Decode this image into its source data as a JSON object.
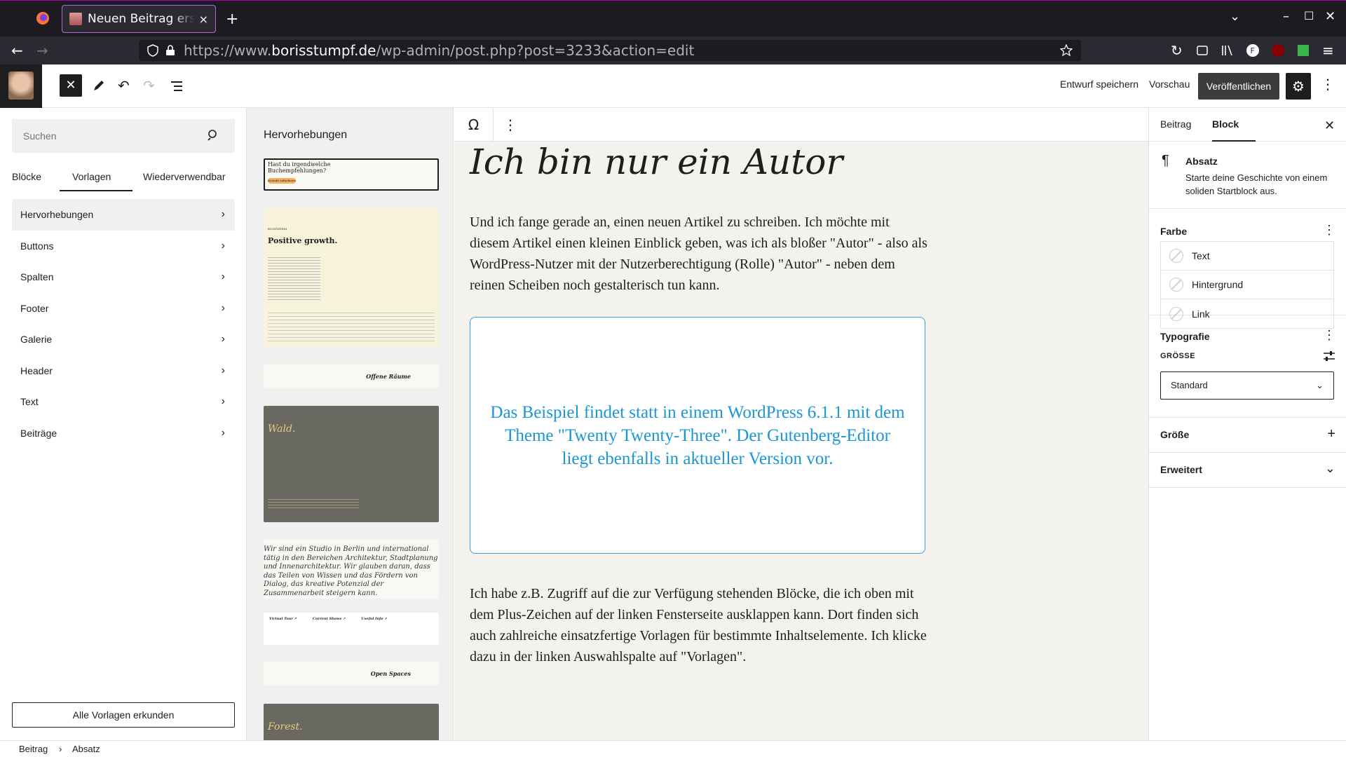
{
  "browser": {
    "tab_title": "Neuen Beitrag erstellen",
    "tab_close": "×",
    "new_tab": "+",
    "url_host_prefix": "https://www.",
    "url_host": "borisstumpf.de",
    "url_path": "/wp-admin/post.php?post=3233&action=edit"
  },
  "wp_topbar": {
    "close_symbol": "✕",
    "save_draft": "Entwurf speichern",
    "preview": "Vorschau",
    "publish": "Veröffentlichen"
  },
  "inserter": {
    "search_placeholder": "Suchen",
    "tabs": [
      "Blöcke",
      "Vorlagen",
      "Wiederverwendbar"
    ],
    "active_tab": "Vorlagen",
    "categories": [
      "Hervorhebungen",
      "Buttons",
      "Spalten",
      "Footer",
      "Galerie",
      "Header",
      "Text",
      "Beiträge"
    ],
    "explore_button": "Alle Vorlagen erkunden"
  },
  "patterns": {
    "title": "Hervorhebungen",
    "p1_text": "Hast du irgendwelche Buchempfehlungen?",
    "p1_button": "Kontakt aufnehmen",
    "p2_kicker": "ECOSYSTEM",
    "p2_heading": "Positive growth.",
    "p3_text": "Offene Räume",
    "p4_text": "Wald.",
    "p5_text": "Wir sind ein Studio in Berlin und international tätig in den Bereichen Architektur, Stadtplanung und Innenarchitektur. Wir glauben daran, dass das Teilen von Wissen und das Fördern von Dialog, das kreative Potenzial der Zusammenarbeit steigern kann.",
    "p6_cols": [
      "Virtual Tour ↗",
      "Current Shows ↗",
      "Useful Info ↗"
    ],
    "p7_text": "Open Spaces",
    "p8_text": "Forest."
  },
  "editor": {
    "omega": "Ω",
    "heading": "Ich bin nur ein Autor",
    "para1": "Und ich fange gerade an, einen neuen Artikel zu schreiben. Ich möchte mit diesem Artikel einen kleinen Einblick geben, was ich als bloßer \"Autor\" - also als WordPress-Nutzer mit der Nutzerberechtigung (Rolle) \"Autor\" - neben dem reinen Scheiben noch gestalterisch tun kann.",
    "callout": "Das Beispiel findet statt in einem WordPress 6.1.1 mit dem Theme \"Twenty Twenty-Three\". Der Gutenberg-Editor liegt ebenfalls in aktueller Version vor.",
    "para2": "Ich habe z.B. Zugriff auf die zur Verfügung stehenden Blöcke, die ich oben mit dem Plus-Zeichen auf der linken Fensterseite ausklappen kann. Dort finden sich auch zahlreiche einsatzfertige Vorlagen für bestimmte Inhaltselemente. Ich klicke dazu in der linken Auswahlspalte auf \"Vorlagen\"."
  },
  "sidebar": {
    "tab_post": "Beitrag",
    "tab_block": "Block",
    "block_name": "Absatz",
    "block_desc": "Starte deine Geschichte von einem soliden Startblock aus.",
    "color_title": "Farbe",
    "color_items": [
      "Text",
      "Hintergrund",
      "Link"
    ],
    "typo_title": "Typografie",
    "size_label": "GRÖSSE",
    "size_value": "Standard",
    "dimension_title": "Größe",
    "advanced_title": "Erweitert"
  },
  "footer": {
    "crumb1": "Beitrag",
    "sep": "›",
    "crumb2": "Absatz"
  },
  "colors": {
    "accent_blue": "#1a96d5",
    "canvas_bg": "#f4f2ec",
    "publish_bg": "#3c3c3c"
  }
}
